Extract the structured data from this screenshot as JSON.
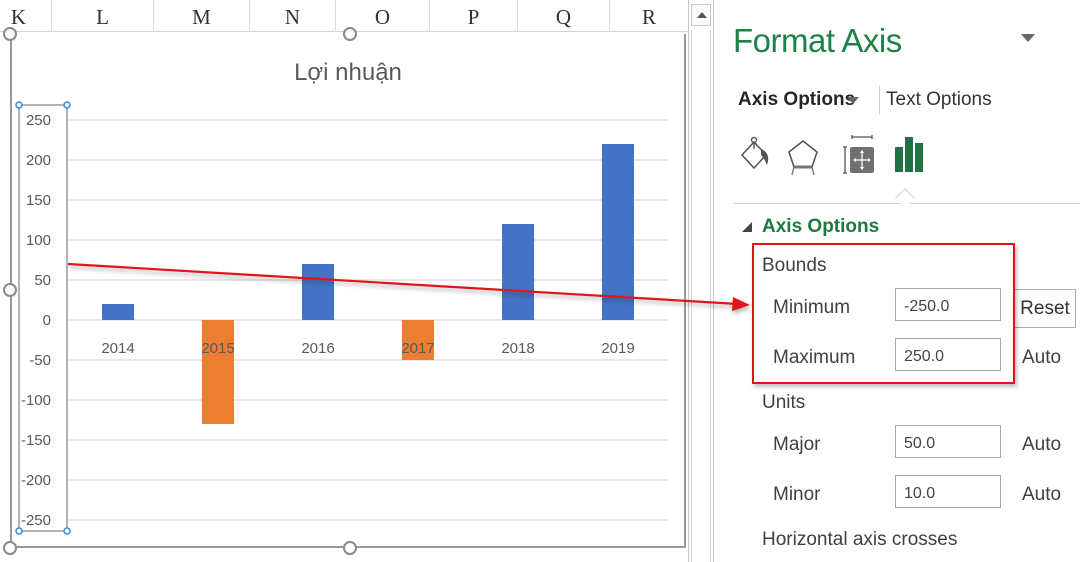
{
  "sheet": {
    "columns": [
      "K",
      "L",
      "M",
      "N",
      "O",
      "P",
      "Q",
      "R"
    ]
  },
  "chart_data": {
    "type": "bar",
    "title": "Lợi nhuận",
    "categories": [
      "2014",
      "2015",
      "2016",
      "2017",
      "2018",
      "2019"
    ],
    "values": [
      20,
      -130,
      70,
      -50,
      120,
      220
    ],
    "colors": [
      "#4472c4",
      "#ed7d31",
      "#4472c4",
      "#ed7d31",
      "#4472c4",
      "#4472c4"
    ],
    "positive_color": "#4472c4",
    "negative_color": "#ed7d31",
    "xlabel": "",
    "ylabel": "",
    "ylim": [
      -250,
      250
    ],
    "major_unit": 50,
    "y_ticks": [
      "250",
      "200",
      "150",
      "100",
      "50",
      "0",
      "-50",
      "-100",
      "-150",
      "-200",
      "-250"
    ],
    "grid": true,
    "legend": "none"
  },
  "annotation": {
    "arrow_color": "#e0141c",
    "highlight_color": "#e0141c"
  },
  "pane": {
    "title": "Format Axis",
    "tabs": {
      "axis_options": "Axis Options",
      "text_options": "Text Options"
    },
    "icons": [
      "fill-line-icon",
      "effects-icon",
      "size-properties-icon",
      "axis-options-icon"
    ],
    "accent_color": "#1e8248",
    "section_title": "Axis Options",
    "bounds": {
      "label": "Bounds",
      "minimum_label": "Minimum",
      "minimum_value": "-250.0",
      "minimum_action": "Reset",
      "maximum_label": "Maximum",
      "maximum_value": "250.0",
      "maximum_action": "Auto"
    },
    "units": {
      "label": "Units",
      "major_label": "Major",
      "major_value": "50.0",
      "major_action": "Auto",
      "minor_label": "Minor",
      "minor_value": "10.0",
      "minor_action": "Auto"
    },
    "horizontal_axis_crosses_label": "Horizontal axis crosses"
  }
}
